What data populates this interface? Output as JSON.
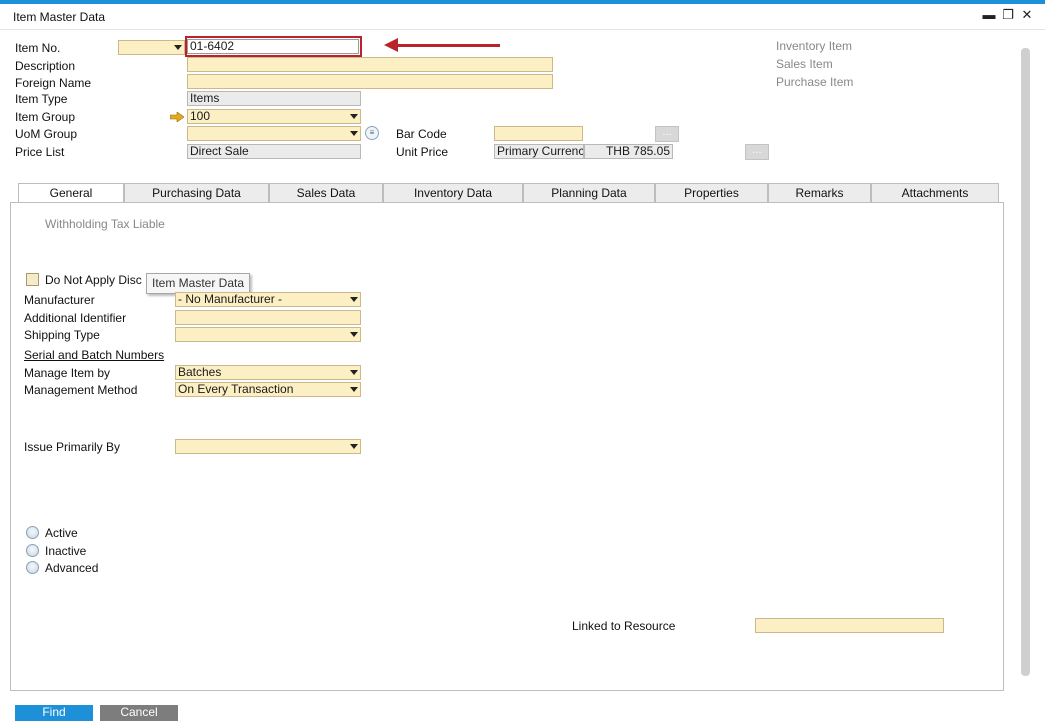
{
  "window": {
    "title": "Item Master Data"
  },
  "header": {
    "item_no_label": "Item No.",
    "item_no_value": "01-6402",
    "description_label": "Description",
    "foreign_name_label": "Foreign Name",
    "item_type_label": "Item Type",
    "item_type_value": "Items",
    "item_group_label": "Item Group",
    "item_group_value": "100",
    "uom_group_label": "UoM Group",
    "price_list_label": "Price List",
    "price_list_value": "Direct Sale",
    "bar_code_label": "Bar Code",
    "unit_price_label": "Unit Price",
    "unit_price_currency": "Primary Currenc",
    "unit_price_value": "THB 785.05",
    "dots": "...",
    "inventory_item": "Inventory Item",
    "sales_item": "Sales Item",
    "purchase_item": "Purchase Item"
  },
  "tabs": [
    "General",
    "Purchasing Data",
    "Sales Data",
    "Inventory Data",
    "Planning Data",
    "Properties",
    "Remarks",
    "Attachments"
  ],
  "general": {
    "withholding_tax": "Withholding Tax Liable",
    "do_not_apply_disc": "Do Not Apply Disc",
    "tooltip": "Item Master Data",
    "manufacturer_label": "Manufacturer",
    "manufacturer_value": "- No Manufacturer -",
    "additional_identifier_label": "Additional Identifier",
    "shipping_type_label": "Shipping Type",
    "serial_batch_header": "Serial and Batch Numbers",
    "manage_item_by_label": "Manage Item by",
    "manage_item_by_value": "Batches",
    "management_method_label": "Management Method",
    "management_method_value": "On Every Transaction",
    "issue_primarily_by_label": "Issue Primarily By",
    "radio_active": "Active",
    "radio_inactive": "Inactive",
    "radio_advanced": "Advanced",
    "linked_to_resource_label": "Linked to Resource"
  },
  "footer": {
    "find_button": "Find",
    "cancel_button": "Cancel"
  },
  "colors": {
    "accent": "#1e90d8",
    "field": "#fcefc3",
    "annotation": "#b8242a"
  }
}
